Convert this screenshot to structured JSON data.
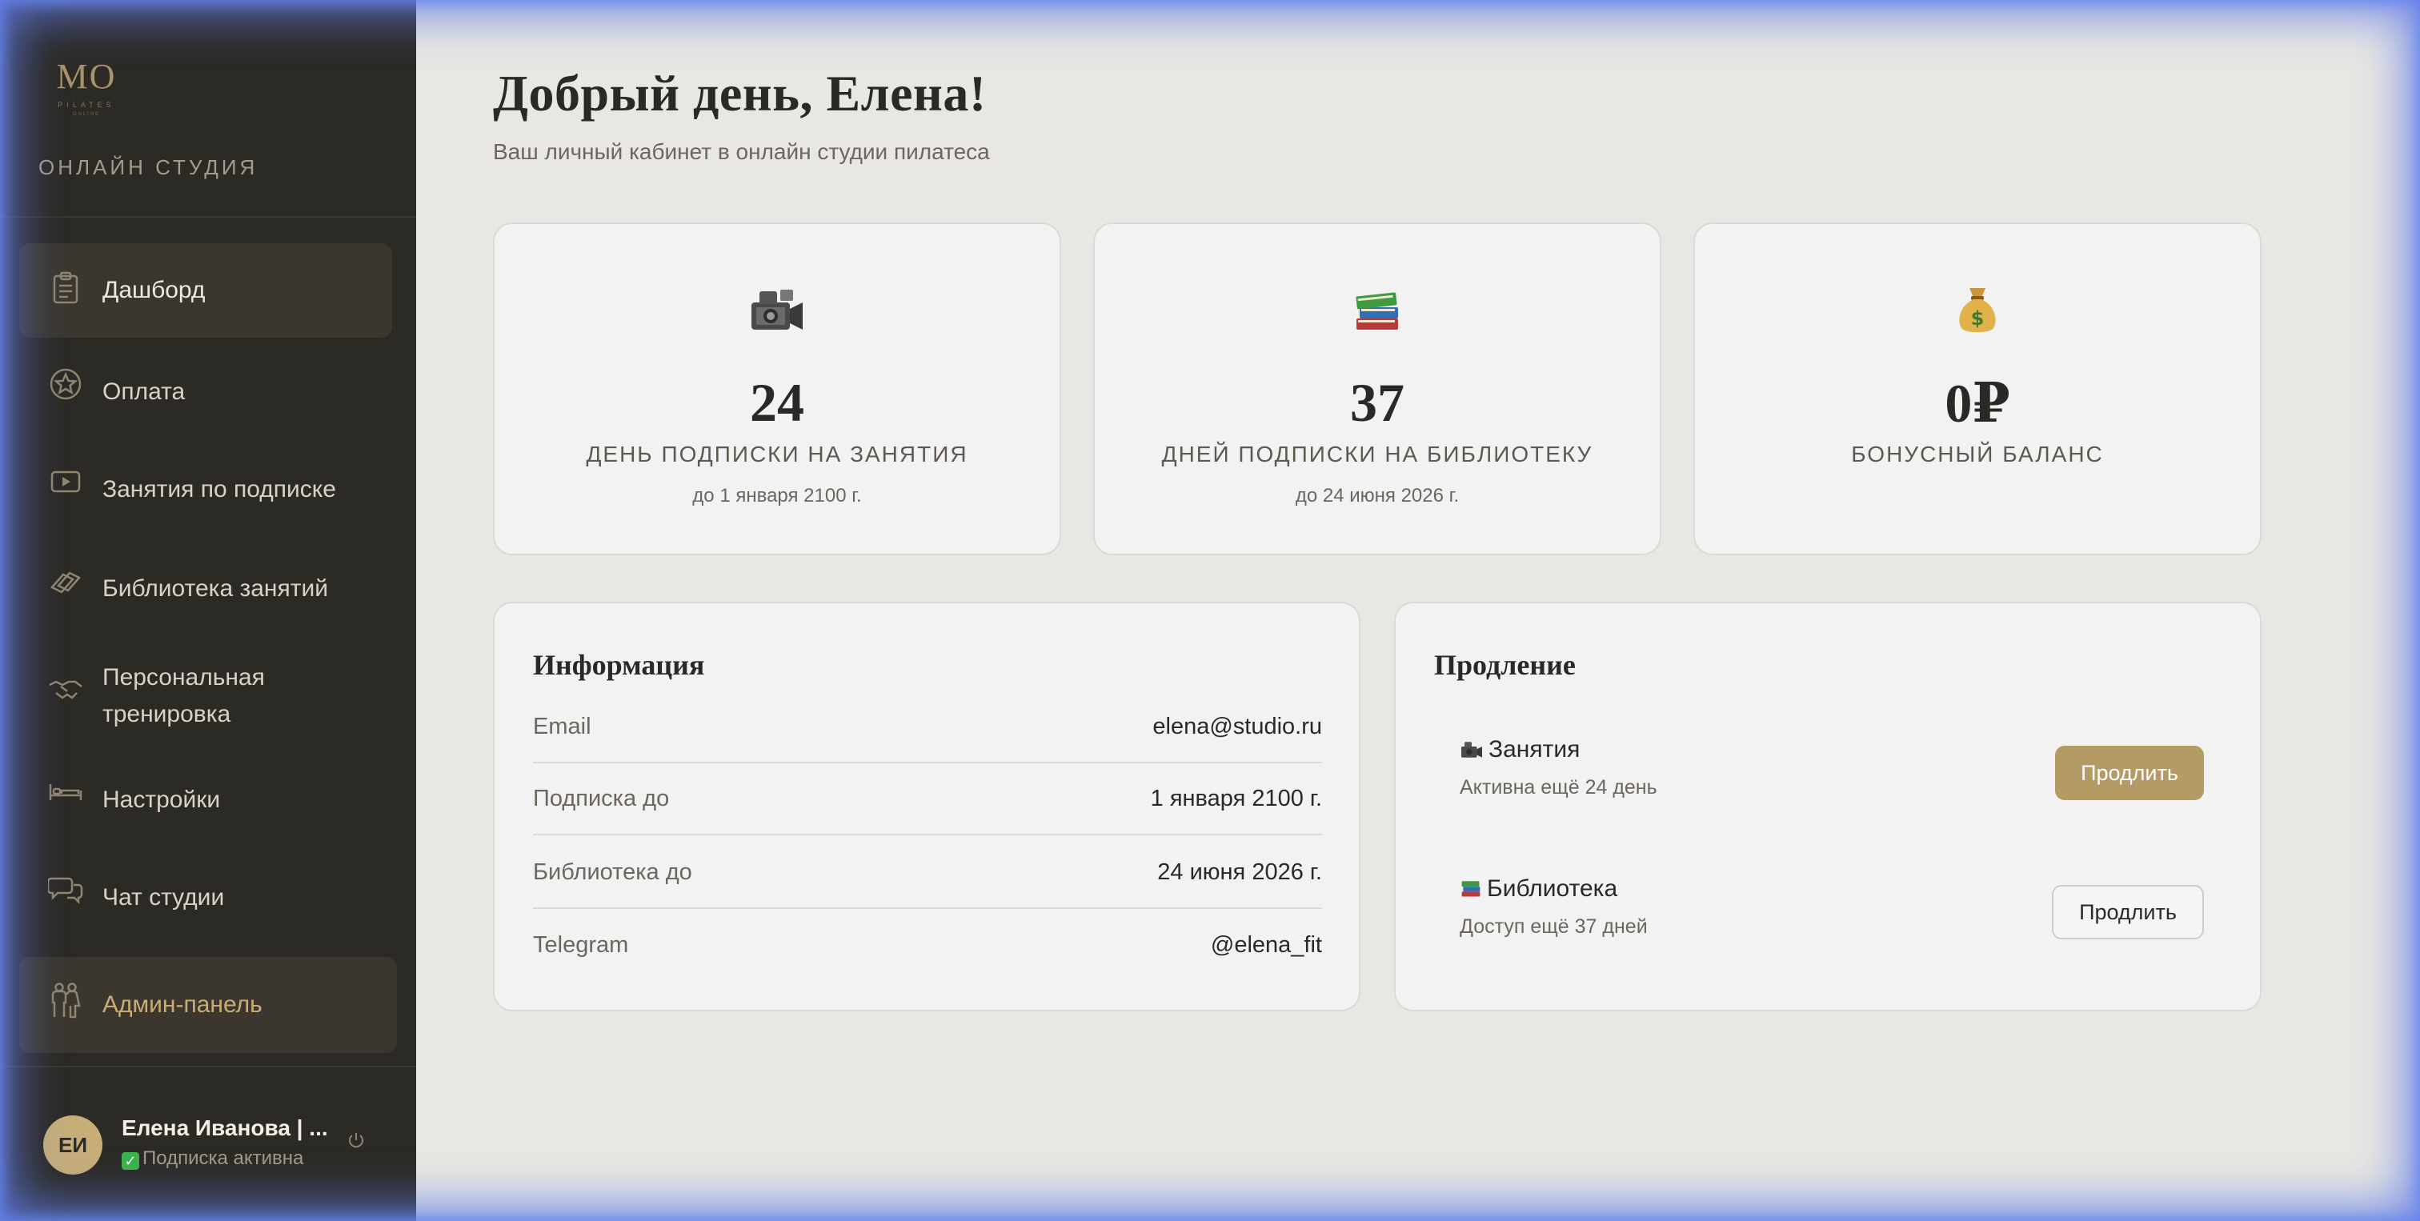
{
  "sidebar": {
    "logo": {
      "mark": "MO",
      "sub": "PILATES",
      "sub2": "ONLINE"
    },
    "studio_label": "ОНЛАЙН СТУДИЯ",
    "items": [
      {
        "label": "Дашборд",
        "icon": "clipboard-icon"
      },
      {
        "label": "Оплата",
        "icon": "star-badge-icon"
      },
      {
        "label": "Занятия по подписке",
        "icon": "video-play-icon"
      },
      {
        "label": "Библиотека занятий",
        "icon": "books-icon"
      },
      {
        "label": "Персональная тренировка",
        "icon": "handshake-icon"
      },
      {
        "label": "Настройки",
        "icon": "bed-icon"
      },
      {
        "label": "Чат студии",
        "icon": "chat-bubbles-icon"
      },
      {
        "label": "Админ-панель",
        "icon": "people-icon"
      }
    ],
    "user": {
      "initials": "ЕИ",
      "name": "Елена Иванова | ...",
      "status": "Подписка активна"
    }
  },
  "header": {
    "title": "Добрый день, Елена!",
    "subtitle": "Ваш личный кабинет в онлайн студии пилатеса"
  },
  "stats": [
    {
      "icon": "video-camera-icon",
      "value": "24",
      "label": "ДЕНЬ ПОДПИСКИ НА ЗАНЯТИЯ",
      "note": "до 1 января 2100 г."
    },
    {
      "icon": "books-icon",
      "value": "37",
      "label": "ДНЕЙ ПОДПИСКИ НА БИБЛИОТЕКУ",
      "note": "до 24 июня 2026 г."
    },
    {
      "icon": "money-bag-icon",
      "value": "0₽",
      "label": "БОНУСНЫЙ БАЛАНС",
      "note": ""
    }
  ],
  "info": {
    "title": "Информация",
    "rows": [
      {
        "key": "Email",
        "value": "elena@studio.ru"
      },
      {
        "key": "Подписка до",
        "value": "1 января 2100 г."
      },
      {
        "key": "Библиотека до",
        "value": "24 июня 2026 г."
      },
      {
        "key": "Telegram",
        "value": "@elena_fit"
      }
    ]
  },
  "renew": {
    "title": "Продление",
    "items": [
      {
        "name": "Занятия",
        "sub": "Активна ещё 24 день",
        "button": "Продлить",
        "icon": "video-camera-icon"
      },
      {
        "name": "Библиотека",
        "sub": "Доступ ещё 37 дней",
        "button": "Продлить",
        "icon": "books-icon"
      }
    ]
  },
  "colors": {
    "sidebar_bg": "#2c2a25",
    "main_bg": "#e9e7e3",
    "accent_gold": "#b49a65",
    "admin_text": "#c9ad74",
    "frame_glow": "#5f7de6"
  }
}
